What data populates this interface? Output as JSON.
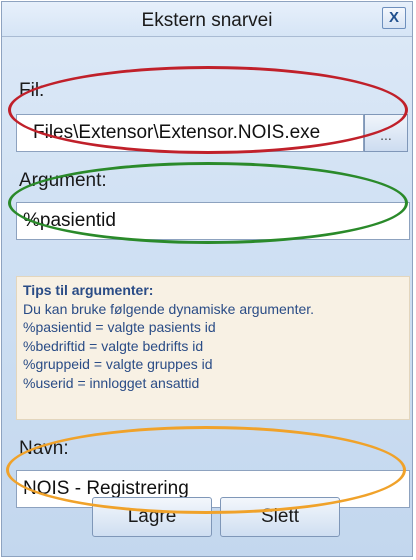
{
  "dialog": {
    "title": "Ekstern snarvei",
    "close_label": "X"
  },
  "file": {
    "label": "Fil:",
    "value": "Files\\Extensor\\Extensor.NOIS.exe",
    "browse_label": "..."
  },
  "argument": {
    "label": "Argument:",
    "value": "%pasientid"
  },
  "tips": {
    "title": "Tips til argumenter:",
    "lines": [
      "Du kan bruke følgende dynamiske argumenter.",
      "%pasientid = valgte pasients id",
      "%bedriftid = valgte bedrifts id",
      "%gruppeid = valgte gruppes id",
      "%userid = innlogget ansattid"
    ]
  },
  "name": {
    "label": "Navn:",
    "value": "NOIS - Registrering"
  },
  "buttons": {
    "save_label": "Lagre",
    "delete_label": "Slett"
  },
  "colors": {
    "annotation_file": "#c0202a",
    "annotation_argument": "#2a8a2a",
    "annotation_name": "#f0a22a"
  }
}
